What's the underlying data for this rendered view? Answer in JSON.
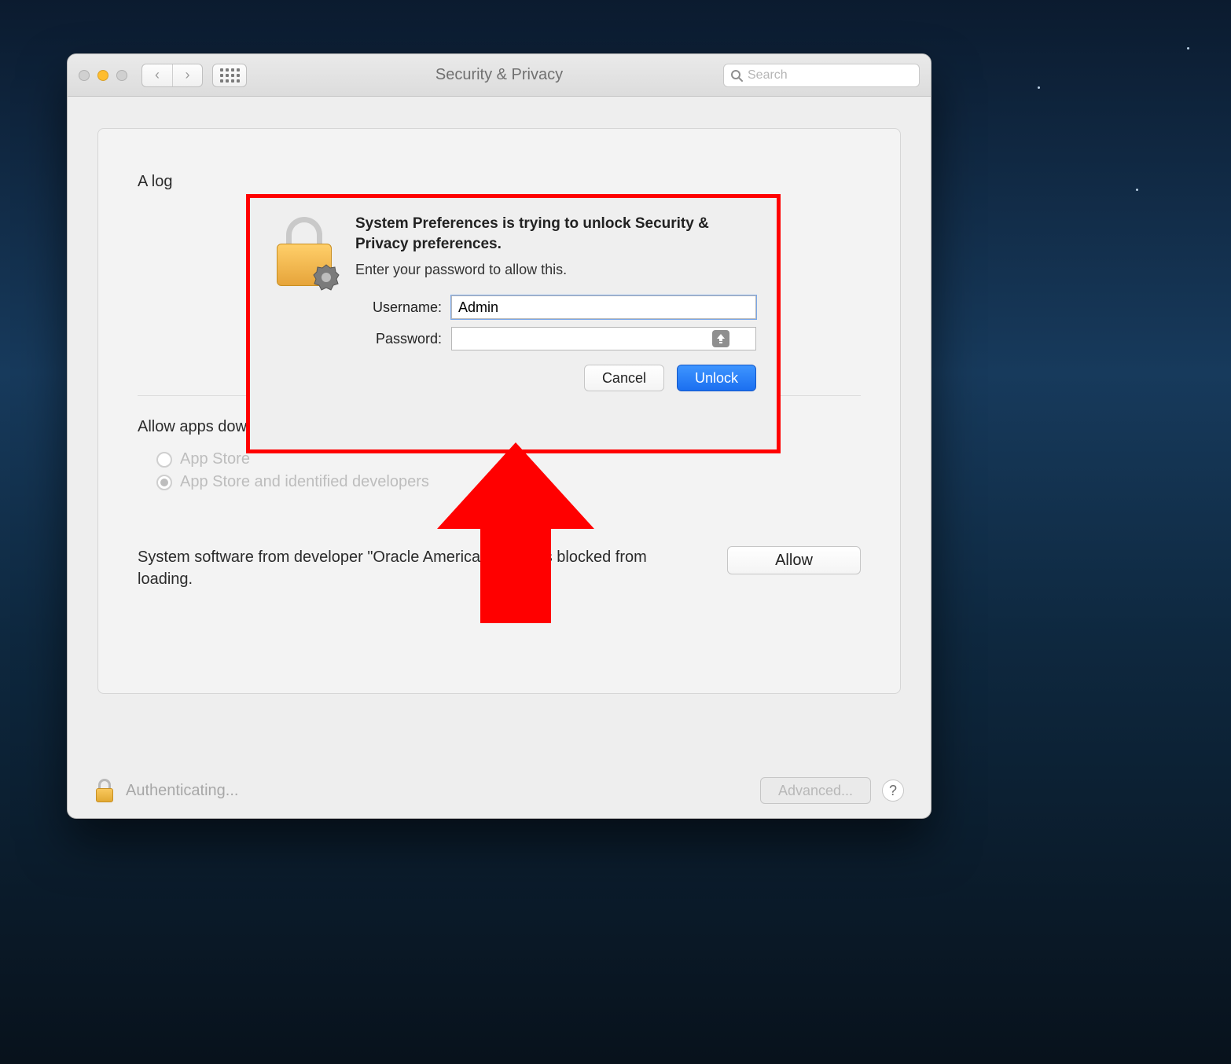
{
  "window": {
    "title": "Security & Privacy",
    "search_placeholder": "Search"
  },
  "panel": {
    "login_line_prefix": "A log",
    "allow_label": "Allow apps downloaded from:",
    "radio_app_store": "App Store",
    "radio_identified": "App Store and identified developers",
    "radio_selected": "identified",
    "blocked_message": "System software from developer \"Oracle America, Inc.\" was blocked from loading.",
    "allow_button": "Allow"
  },
  "footer": {
    "status": "Authenticating...",
    "advanced_button": "Advanced...",
    "help": "?"
  },
  "auth_dialog": {
    "heading": "System Preferences is trying to unlock Security & Privacy preferences.",
    "subheading": "Enter your password to allow this.",
    "username_label": "Username:",
    "username_value": "Admin",
    "password_label": "Password:",
    "password_value": "",
    "cancel_button": "Cancel",
    "unlock_button": "Unlock"
  }
}
